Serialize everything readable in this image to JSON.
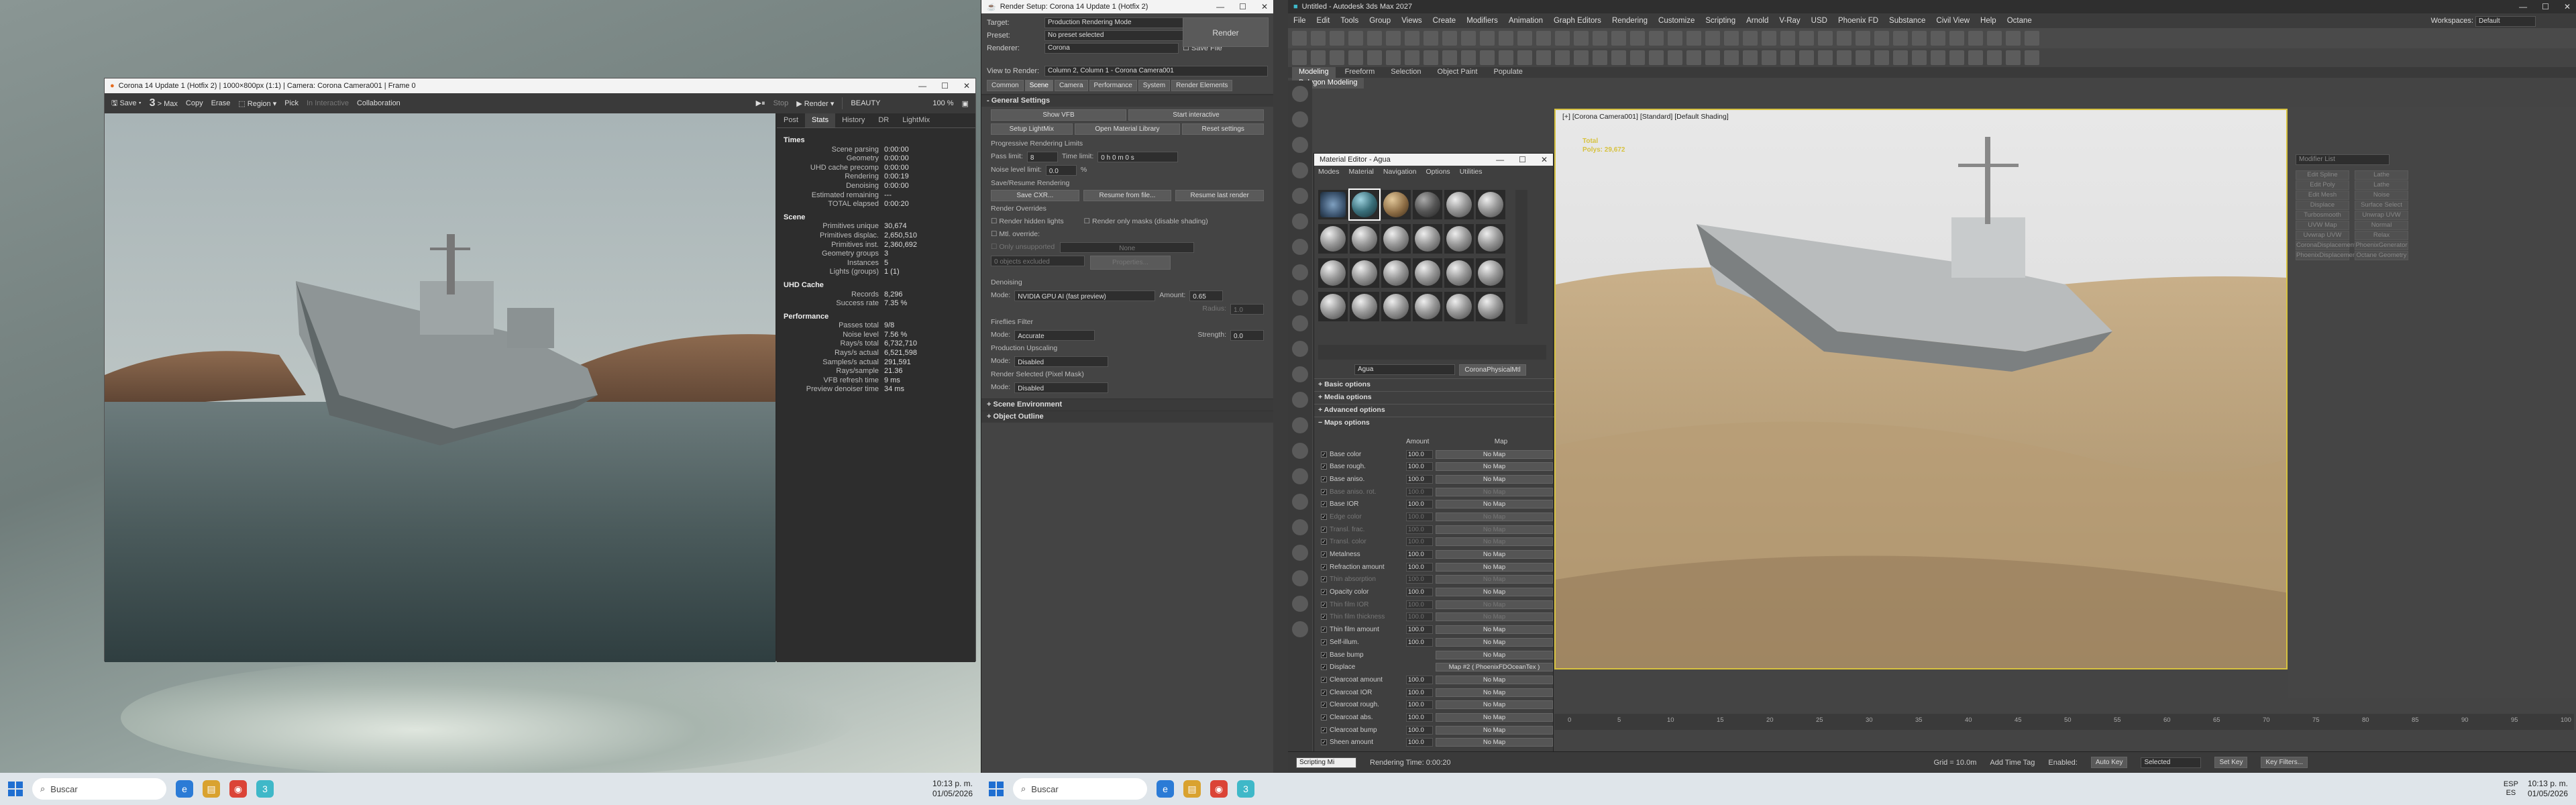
{
  "colors": {
    "accent": "#d7c23f",
    "taskbar": "#dfe5ea"
  },
  "vfb": {
    "title": "Corona 14 Update 1 (Hotfix 2) | 1000×800px (1:1) | Camera: Corona Camera001 | Frame 0",
    "tool": {
      "save": "Save",
      "max": "> Max",
      "copy": "Copy",
      "erase": "Erase",
      "region": "Region",
      "pick": "Pick",
      "interactive": "In Interactive",
      "collab": "Collaboration",
      "stop": "Stop",
      "render": "Render"
    },
    "channel": "BEAUTY",
    "zoom": "100 %",
    "tabs": [
      "Post",
      "Stats",
      "History",
      "DR",
      "LightMix"
    ],
    "stats": [
      {
        "h": "Times",
        "rows": [
          [
            "Scene parsing",
            "0:00:00"
          ],
          [
            "Geometry",
            "0:00:00"
          ],
          [
            "UHD cache precomp",
            "0:00:00"
          ],
          [
            "Rendering",
            "0:00:19"
          ],
          [
            "Denoising",
            "0:00:00"
          ],
          [
            "Estimated remaining",
            "---"
          ],
          [
            "TOTAL elapsed",
            "0:00:20"
          ]
        ]
      },
      {
        "h": "Scene",
        "rows": [
          [
            "Primitives unique",
            "30,674"
          ],
          [
            "Primitives displac.",
            "2,650,510"
          ],
          [
            "Primitives inst.",
            "2,360,692"
          ],
          [
            "Geometry groups",
            "3"
          ],
          [
            "Instances",
            "5"
          ],
          [
            "Lights (groups)",
            "1 (1)"
          ]
        ]
      },
      {
        "h": "UHD Cache",
        "rows": [
          [
            "Records",
            "8,296"
          ],
          [
            "Success rate",
            "7.35 %"
          ]
        ]
      },
      {
        "h": "Performance",
        "rows": [
          [
            "Passes total",
            "9/8"
          ],
          [
            "Noise level",
            "7.56 %"
          ],
          [
            "Rays/s total",
            "6,732,710"
          ],
          [
            "Rays/s actual",
            "6,521,598"
          ],
          [
            "Samples/s actual",
            "291,591"
          ],
          [
            "Rays/sample",
            "21.36"
          ],
          [
            "VFB refresh time",
            "9 ms"
          ],
          [
            "Preview denoiser time",
            "34 ms"
          ]
        ]
      }
    ]
  },
  "rs": {
    "title": "Render Setup: Corona 14 Update 1 (Hotfix 2)",
    "target_label": "Target:",
    "target": "Production Rendering Mode",
    "preset_label": "Preset:",
    "preset": "No preset selected",
    "renderer_label": "Renderer:",
    "renderer": "Corona",
    "save_file": "Save File",
    "render_btn": "Render",
    "view_label": "View to Render:",
    "view": "Column 2, Column 1 - Corona Camera001",
    "tabs": [
      "Common",
      "Scene",
      "Camera",
      "Performance",
      "System",
      "Render Elements"
    ],
    "general": "General Settings",
    "buttons": [
      "Show VFB",
      "Start interactive",
      "Setup LightMix",
      "Open Material Library",
      "Reset settings"
    ],
    "prl": "Progressive Rendering Limits",
    "pass_limit": "Pass limit:",
    "pass_val": "8",
    "time_limit": "Time limit:",
    "time_val": "0 h  0 m  0 s",
    "noise_limit": "Noise level limit:",
    "noise_val": "0.0",
    "pct": "%",
    "saveres": "Save/Resume Rendering",
    "saveres_btns": [
      "Save CXR...",
      "Resume from file...",
      "Resume last render"
    ],
    "overrides": "Render Overrides",
    "hidden_lights": "Render hidden lights",
    "masks_only": "Render only masks (disable shading)",
    "mtl_override": "Mtl. override:",
    "mtl_none": "None",
    "only_unsupported": "Only unsupported",
    "exclude": "0 objects excluded",
    "properties": "Properties...",
    "denoising": "Denoising",
    "mode_label": "Mode:",
    "den_mode": "NVIDIA GPU AI (fast preview)",
    "amount_label": "Amount:",
    "amount": "0.65",
    "radius_label": "Radius:",
    "radius": "1.0",
    "fireflies": "Fireflies Filter",
    "ff_mode": "Accurate",
    "strength_label": "Strength:",
    "strength": "0.0",
    "upscale": "Production Upscaling",
    "up_mode": "Disabled",
    "rsel": "Render Selected (Pixel Mask)",
    "rsel_mode": "Disabled",
    "scene_env": "Scene Environment",
    "obj_outline": "Object Outline"
  },
  "max": {
    "title": "Untitled - Autodesk 3ds Max 2027",
    "menus": [
      "File",
      "Edit",
      "Tools",
      "Group",
      "Views",
      "Create",
      "Modifiers",
      "Animation",
      "Graph Editors",
      "Rendering",
      "Customize",
      "Scripting",
      "Arnold",
      "V-Ray",
      "USD",
      "Phoenix FD",
      "Substance",
      "Civil View",
      "Help",
      "Octane"
    ],
    "workspaces_label": "Workspaces:",
    "workspace": "Default",
    "ribbon": [
      "Modeling",
      "Freeform",
      "Selection",
      "Object Paint",
      "Populate"
    ],
    "poly": "Polygon Modeling",
    "vp_label": "[+] [Corona Camera001] [Standard] [Default Shading]",
    "vp_total": "Total",
    "vp_polys": "Polys: 29,672",
    "cmd_buttons": [
      "Edit Spline",
      "Lathe",
      "Edit Poly",
      "Lathe",
      "Edit Mesh",
      "Noise",
      "Displace",
      "Surface Select",
      "Turbosmooth",
      "Unwrap UVW",
      "UVW Map",
      "Normal",
      "Uvwrap UVW",
      "Relax",
      "CoronaDisplacementMod",
      "PhoenixGenerator",
      "PhoenixDisplacementMod",
      "Octane Geometry"
    ],
    "modifier_list": "Modifier List",
    "timeline": [
      "0",
      "5",
      "10",
      "15",
      "20",
      "25",
      "30",
      "35",
      "40",
      "45",
      "50",
      "55",
      "60",
      "65",
      "70",
      "75",
      "80",
      "85",
      "90",
      "95",
      "100"
    ],
    "status": {
      "script": "Scripting Mi",
      "render_time": "Rendering Time: 0:00:20",
      "grid": "Grid = 10.0m",
      "auto": "Auto Key",
      "selected": "Selected",
      "set_key": "Set Key",
      "filters": "Key Filters...",
      "add_tag": "Add Time Tag",
      "enabled": "Enabled:"
    }
  },
  "med": {
    "title": "Material Editor - Agua",
    "menus": [
      "Modes",
      "Material",
      "Navigation",
      "Options",
      "Utilities"
    ],
    "mat_name": "Agua",
    "mat_type": "CoronaPhysicalMtl",
    "rollouts": [
      "Basic options",
      "Media options",
      "Advanced options",
      "Maps options"
    ],
    "amount_hdr": "Amount",
    "map_hdr": "Map",
    "maps": [
      {
        "n": "Base color",
        "a": "100.0",
        "m": "No Map",
        "d": false
      },
      {
        "n": "Base rough.",
        "a": "100.0",
        "m": "No Map",
        "d": false
      },
      {
        "n": "Base aniso.",
        "a": "100.0",
        "m": "No Map",
        "d": false
      },
      {
        "n": "Base aniso. rot.",
        "a": "100.0",
        "m": "No Map",
        "d": true
      },
      {
        "n": "Base IOR",
        "a": "100.0",
        "m": "No Map",
        "d": false
      },
      {
        "n": "Edge color",
        "a": "100.0",
        "m": "No Map",
        "d": true
      },
      {
        "n": "Transl. frac.",
        "a": "100.0",
        "m": "No Map",
        "d": true
      },
      {
        "n": "Transl. color",
        "a": "100.0",
        "m": "No Map",
        "d": true
      },
      {
        "n": "Metalness",
        "a": "100.0",
        "m": "No Map",
        "d": false
      },
      {
        "n": "Refraction amount",
        "a": "100.0",
        "m": "No Map",
        "d": false
      },
      {
        "n": "Thin absorption",
        "a": "100.0",
        "m": "No Map",
        "d": true
      },
      {
        "n": "Opacity color",
        "a": "100.0",
        "m": "No Map",
        "d": false
      },
      {
        "n": "Thin film IOR",
        "a": "100.0",
        "m": "No Map",
        "d": true
      },
      {
        "n": "Thin film thickness",
        "a": "100.0",
        "m": "No Map",
        "d": true
      },
      {
        "n": "Thin film amount",
        "a": "100.0",
        "m": "No Map",
        "d": false
      },
      {
        "n": "Self-illum.",
        "a": "100.0",
        "m": "No Map",
        "d": false
      },
      {
        "n": "Base bump",
        "a": "",
        "m": "No Map",
        "d": false
      },
      {
        "n": "Displace",
        "a": "",
        "m": "Map #2 ( PhoenixFDOceanTex )",
        "d": false
      },
      {
        "n": "Clearcoat amount",
        "a": "100.0",
        "m": "No Map",
        "d": false
      },
      {
        "n": "Clearcoat IOR",
        "a": "100.0",
        "m": "No Map",
        "d": false
      },
      {
        "n": "Clearcoat rough.",
        "a": "100.0",
        "m": "No Map",
        "d": false
      },
      {
        "n": "Clearcoat abs.",
        "a": "100.0",
        "m": "No Map",
        "d": false
      },
      {
        "n": "Clearcoat bump",
        "a": "100.0",
        "m": "No Map",
        "d": false
      },
      {
        "n": "Sheen amount",
        "a": "100.0",
        "m": "No Map",
        "d": false
      }
    ]
  },
  "taskbar": {
    "search": "Buscar",
    "time": "10:13 p. m.",
    "date": "01/05/2026",
    "lang": "ESP",
    "region": "ES"
  }
}
